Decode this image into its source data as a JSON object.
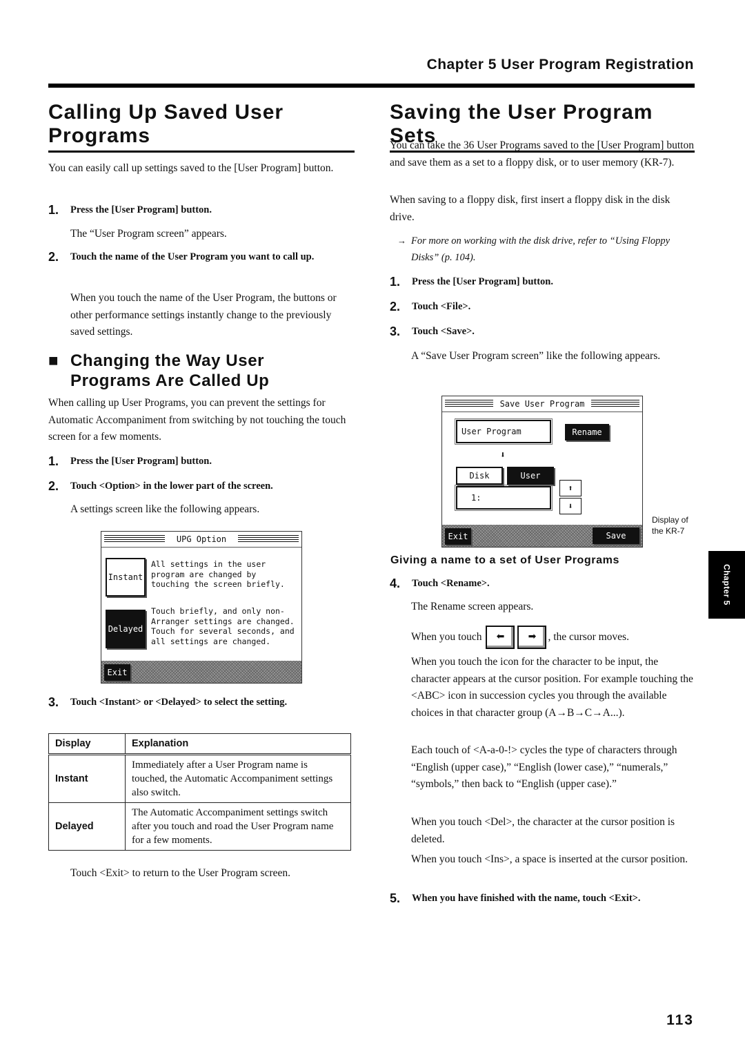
{
  "running_head": "Chapter 5 User Program Registration",
  "page_number": "113",
  "side_tab": "Chapter 5",
  "left": {
    "title_line1": "Calling Up Saved User",
    "title_line2": "Programs",
    "intro": "You can easily call up settings saved to the [User Program] button.",
    "steps_a": [
      {
        "num": "1.",
        "text": "Press the [User Program] button.",
        "desc": "The “User Program screen” appears."
      },
      {
        "num": "2.",
        "text": "Touch the name of the User Program you want to call up.",
        "desc": "When you touch the name of the User Program, the buttons or other performance settings instantly change to the previously saved settings."
      }
    ],
    "subheading_line1": "Changing the Way User",
    "subheading_line2": "Programs Are Called Up",
    "sub_intro": "When calling up User Programs, you can prevent the settings for Automatic Accompaniment from switching by not touching the touch screen for a few moments.",
    "steps_b": [
      {
        "num": "1.",
        "text": "Press the [User Program] button."
      },
      {
        "num": "2.",
        "text": "Touch <Option> in the lower part of the screen.",
        "desc": "A settings screen like the following appears."
      },
      {
        "num": "3.",
        "text": "Touch <Instant> or <Delayed> to select the setting."
      }
    ],
    "screen": {
      "title": "UPG Option",
      "instant_button": "Instant",
      "instant_text": "All settings in the user\nprogram are changed by\ntouching the screen briefly.",
      "delayed_button": "Delayed",
      "delayed_text": "Touch briefly, and only non-\nArranger settings are changed.\nTouch for several seconds, and\nall settings are changed.",
      "exit_button": "Exit"
    },
    "table": {
      "headers": [
        "Display",
        "Explanation"
      ],
      "rows": [
        {
          "display": "Instant",
          "explanation": "Immediately after a User Program name is touched, the Automatic Accompaniment settings also switch."
        },
        {
          "display": "Delayed",
          "explanation": "The Automatic Accompaniment settings switch after you touch and road the User Program name for a few moments."
        }
      ]
    },
    "closing": "Touch <Exit> to return to the User Program screen."
  },
  "right": {
    "title": "Saving the User Program Sets",
    "intro1": "You can take the 36 User Programs saved to the [User Program] button and save them as a set to a floppy disk, or to user memory (KR-7).",
    "intro2": "When saving to a floppy disk, first insert a floppy disk in the disk drive.",
    "note_arrow": "→",
    "note": "For more on working with the disk drive, refer to “Using Floppy Disks” (p. 104).",
    "steps_a": [
      {
        "num": "1.",
        "text": "Press the [User Program] button."
      },
      {
        "num": "2.",
        "text": "Touch <File>."
      },
      {
        "num": "3.",
        "text": "Touch <Save>.",
        "desc": "A “Save User Program screen” like the following appears."
      }
    ],
    "screen": {
      "title": "Save User Program",
      "name_field": "User Program",
      "rename_button": "Rename",
      "disk_button": "Disk",
      "user_button": "User",
      "slot_field": "1:",
      "exit_button": "Exit",
      "save_button": "Save",
      "caption": "Display of the KR-7"
    },
    "subheading": "Giving a name to a set of User Programs",
    "step4": {
      "num": "4.",
      "text": "Touch <Rename>.",
      "desc": "The Rename screen appears."
    },
    "cursor_before": "When you touch",
    "cursor_after": ", the cursor moves.",
    "para_icon": "When you touch the icon for the character to be input, the character appears at the cursor position. For example touching the <ABC> icon in succession cycles you through the available choices in that character group (A→B→C→A...).",
    "para_type": "Each touch of <A-a-0-!> cycles the type of characters through “English (upper case),” “English (lower case),” “numerals,” “symbols,” then back to “English (upper case).”",
    "para_del": "When you touch <Del>, the character at the cursor position is deleted.",
    "para_ins": "When you touch <Ins>, a space is inserted at the cursor position.",
    "step5": {
      "num": "5.",
      "text": "When you have finished with the name, touch <Exit>."
    }
  }
}
